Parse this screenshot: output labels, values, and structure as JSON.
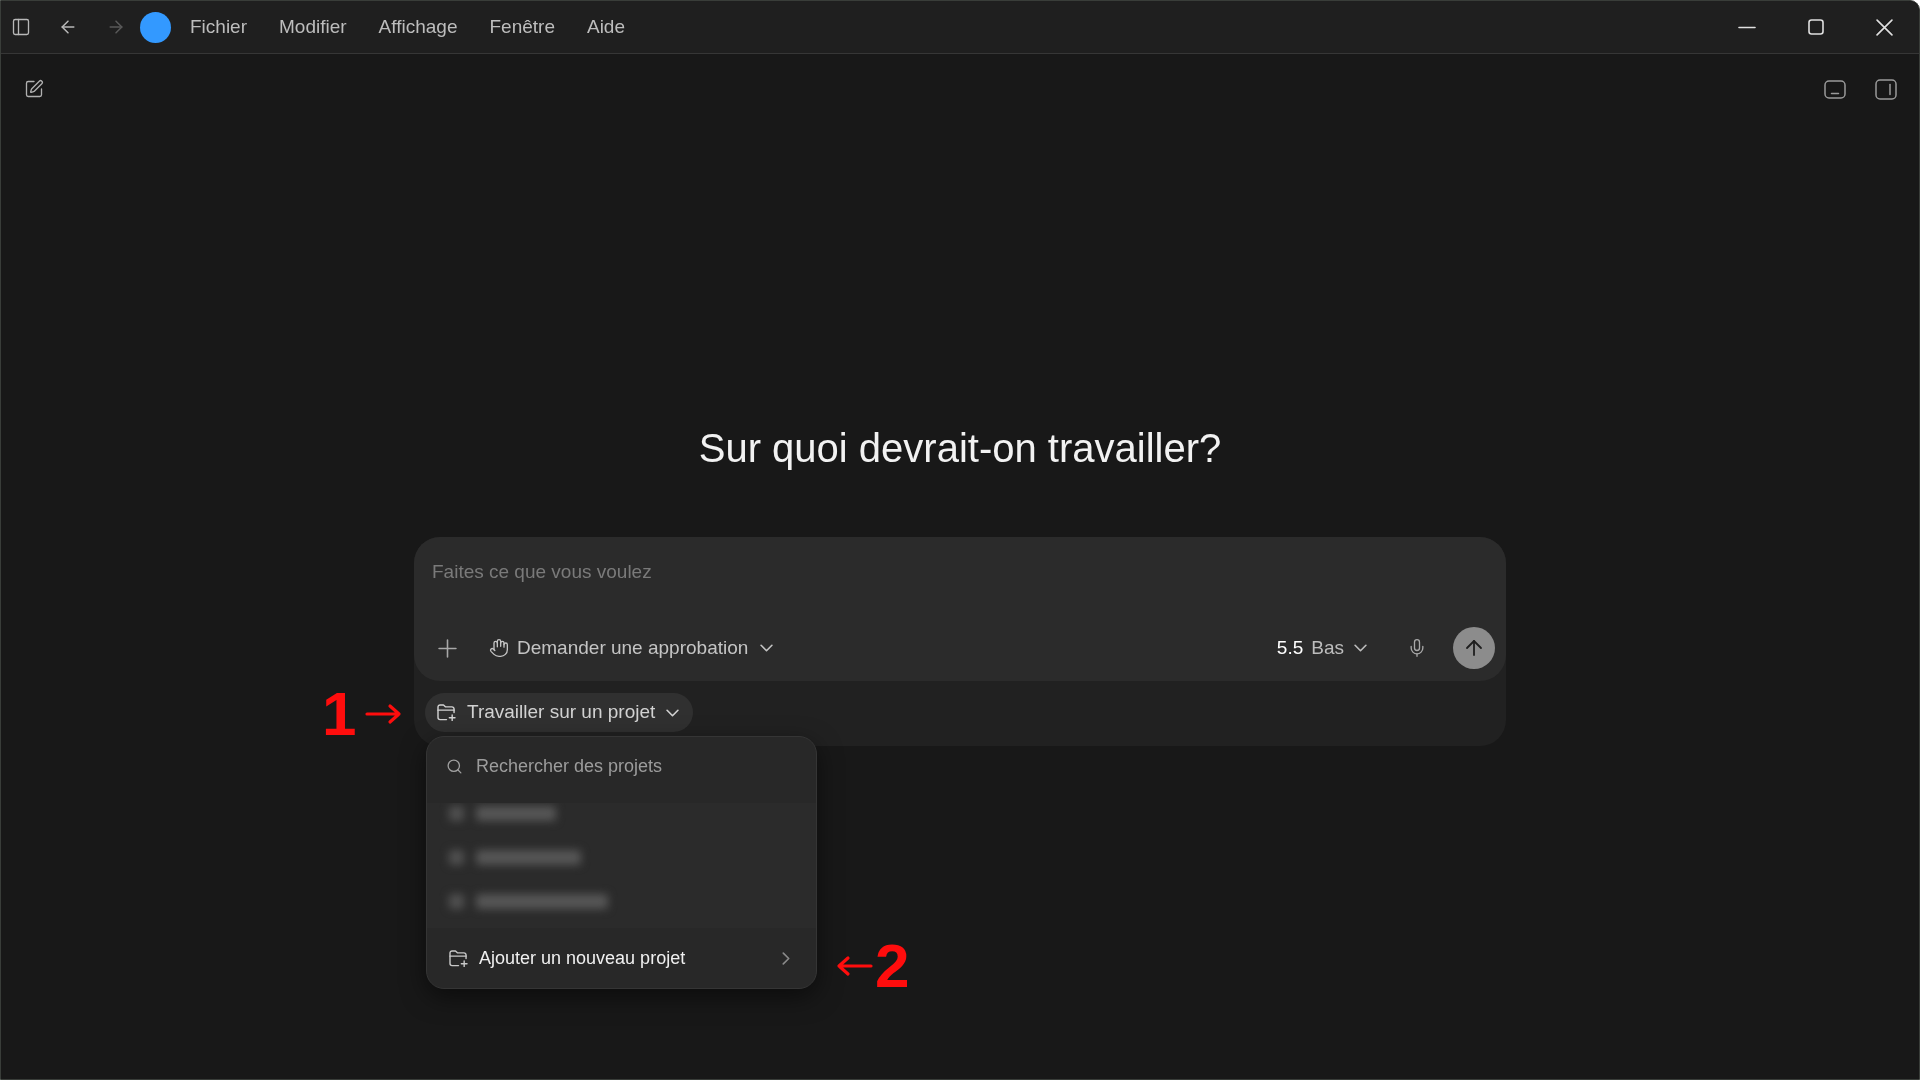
{
  "titlebar": {
    "nav": [
      {
        "kind": "back",
        "disabled": false
      },
      {
        "kind": "forward",
        "disabled": true
      }
    ],
    "menu": [
      "Fichier",
      "Modifier",
      "Affichage",
      "Fenêtre",
      "Aide"
    ]
  },
  "heading": "Sur quoi devrait-on travailler?",
  "composer": {
    "placeholder": "Faites ce que vous voulez",
    "approval": "Demander une approbation",
    "model": {
      "version": "5.5",
      "effort": "Bas"
    },
    "project_button": {
      "label": "Travailler sur un projet",
      "expanded": true
    }
  },
  "project_menu": {
    "search": {
      "placeholder": "Rechercher des projets"
    },
    "add_item": "Ajouter un nouveau projet"
  },
  "annotations": [
    {
      "label": "1",
      "kind": "right"
    },
    {
      "label": "2",
      "kind": "left"
    }
  ]
}
